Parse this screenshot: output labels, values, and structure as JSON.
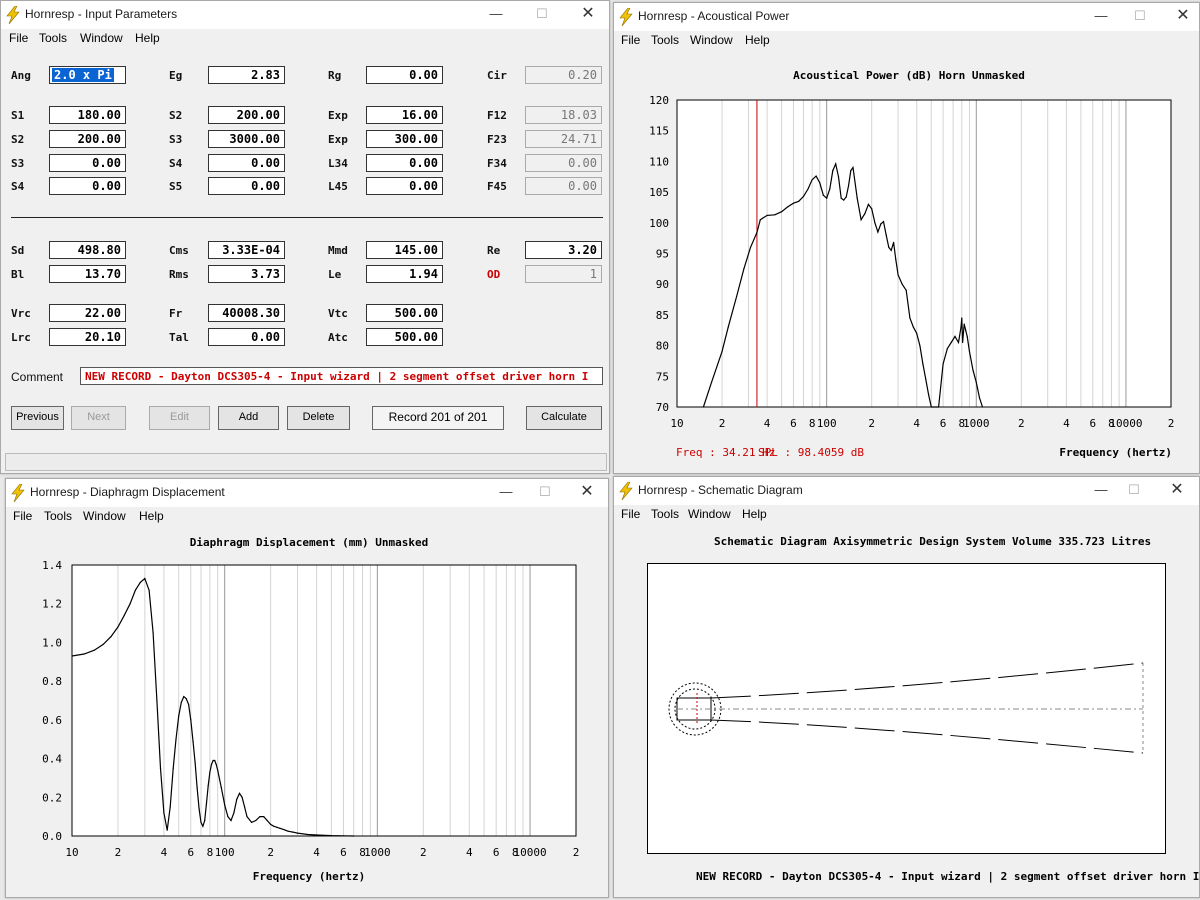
{
  "icons": {
    "app": "hornresp-lightning-icon",
    "minimize": "minimize-icon",
    "maximize": "maximize-icon",
    "close": "close-icon"
  },
  "colors": {
    "red_label": "#cc0000",
    "selection": "#0a64d2",
    "marker": "#cc0000"
  },
  "menu": {
    "file": "File",
    "tools": "Tools",
    "window": "Window",
    "help": "Help"
  },
  "input_window": {
    "title": "Hornresp - Input Parameters",
    "fields": {
      "ang": {
        "label": "Ang",
        "value": "2.0 x Pi"
      },
      "eg": {
        "label": "Eg",
        "value": "2.83"
      },
      "rg": {
        "label": "Rg",
        "value": "0.00"
      },
      "cir": {
        "label": "Cir",
        "value": "0.20"
      },
      "s1": {
        "label": "S1",
        "value": "180.00"
      },
      "s2a": {
        "label": "S2",
        "value": "200.00"
      },
      "exp1": {
        "label": "Exp",
        "value": "16.00"
      },
      "f12": {
        "label": "F12",
        "value": "18.03"
      },
      "s2b": {
        "label": "S2",
        "value": "200.00"
      },
      "s3a": {
        "label": "S3",
        "value": "3000.00"
      },
      "exp2": {
        "label": "Exp",
        "value": "300.00"
      },
      "f23": {
        "label": "F23",
        "value": "24.71"
      },
      "s3b": {
        "label": "S3",
        "value": "0.00"
      },
      "s4a": {
        "label": "S4",
        "value": "0.00"
      },
      "l34": {
        "label": "L34",
        "value": "0.00"
      },
      "f34": {
        "label": "F34",
        "value": "0.00"
      },
      "s4b": {
        "label": "S4",
        "value": "0.00"
      },
      "s5": {
        "label": "S5",
        "value": "0.00"
      },
      "l45": {
        "label": "L45",
        "value": "0.00"
      },
      "f45": {
        "label": "F45",
        "value": "0.00"
      },
      "sd": {
        "label": "Sd",
        "value": "498.80"
      },
      "cms": {
        "label": "Cms",
        "value": "3.33E-04"
      },
      "mmd": {
        "label": "Mmd",
        "value": "145.00"
      },
      "re": {
        "label": "Re",
        "value": "3.20"
      },
      "bl": {
        "label": "Bl",
        "value": "13.70"
      },
      "rms": {
        "label": "Rms",
        "value": "3.73"
      },
      "le": {
        "label": "Le",
        "value": "1.94"
      },
      "od": {
        "label": "OD",
        "value": "1"
      },
      "vrc": {
        "label": "Vrc",
        "value": "22.00"
      },
      "fr": {
        "label": "Fr",
        "value": "40008.30"
      },
      "vtc": {
        "label": "Vtc",
        "value": "500.00"
      },
      "lrc": {
        "label": "Lrc",
        "value": "20.10"
      },
      "tal": {
        "label": "Tal",
        "value": "0.00"
      },
      "atc": {
        "label": "Atc",
        "value": "500.00"
      }
    },
    "comment_label": "Comment",
    "comment_value": "NEW RECORD - Dayton DCS305-4 - Input wizard | 2 segment offset driver horn I",
    "buttons": {
      "previous": "Previous",
      "next": "Next",
      "edit": "Edit",
      "add": "Add",
      "delete": "Delete",
      "calculate": "Calculate"
    },
    "record": "Record 201 of 201"
  },
  "acoustical_window": {
    "title": "Hornresp - Acoustical Power",
    "readout_freq": "Freq : 34.21 Hz",
    "readout_spl": "SPL : 98.4059 dB",
    "chart_data": {
      "type": "line",
      "title": "Acoustical Power (dB)   Horn   Unmasked",
      "xlabel": "Frequency (hertz)",
      "ylabel": "",
      "xscale": "log",
      "xlim": [
        10,
        20000
      ],
      "ylim": [
        70,
        120
      ],
      "x_ticks": [
        "10",
        "2",
        "4",
        "6",
        "8",
        "100",
        "2",
        "4",
        "6",
        "8",
        "1000",
        "2",
        "4",
        "6",
        "8",
        "10000",
        "2"
      ],
      "y_ticks": [
        "120",
        "115",
        "110",
        "105",
        "100",
        "95",
        "90",
        "85",
        "80",
        "75",
        "70"
      ],
      "marker_x": 34.21,
      "series": [
        {
          "x": [
            15,
            17,
            20,
            22,
            25,
            28,
            31,
            34.21,
            36,
            40,
            45,
            50,
            55,
            60,
            65,
            70,
            75,
            80,
            85,
            90,
            95,
            100,
            105,
            110,
            115,
            120,
            125,
            130,
            135,
            140,
            145,
            150,
            160,
            170,
            180,
            190,
            200,
            210,
            220,
            230,
            240,
            250,
            260,
            270,
            280,
            290,
            300,
            320,
            340,
            360,
            380,
            400,
            420,
            440,
            460,
            480,
            500,
            520,
            540,
            560
          ],
          "values": [
            70,
            74,
            79,
            83,
            88,
            92.5,
            96,
            98.4,
            100.5,
            101.2,
            101.3,
            101.8,
            102.6,
            103.2,
            103.5,
            104.3,
            105.5,
            107,
            107.6,
            106.5,
            104.5,
            104,
            105.5,
            108.5,
            109.6,
            107.5,
            104,
            103.7,
            104.2,
            106,
            108.5,
            109,
            104,
            100.5,
            101.5,
            103,
            102.3,
            100,
            98.5,
            99.8,
            100.2,
            98,
            96,
            95.5,
            96.8,
            94,
            91.5,
            90,
            89,
            84.5,
            83,
            82,
            80,
            77,
            74.5,
            72,
            70,
            70,
            70,
            70
          ]
        },
        {
          "x": [
            560,
            600,
            640,
            680,
            720,
            760,
            790,
            800,
            810,
            830,
            850,
            870,
            900,
            950,
            1000,
            1050,
            1100
          ],
          "values": [
            70,
            77,
            79.5,
            80.5,
            81.5,
            80.5,
            83,
            84.5,
            80.5,
            83.5,
            82.5,
            81.5,
            79,
            76,
            74,
            71.5,
            70
          ]
        }
      ]
    }
  },
  "displacement_window": {
    "title": "Hornresp - Diaphragm Displacement",
    "chart_data": {
      "type": "line",
      "title": "Diaphragm Displacement (mm)   Unmasked",
      "xlabel": "Frequency (hertz)",
      "ylabel": "",
      "xscale": "log",
      "xlim": [
        10,
        20000
      ],
      "ylim": [
        0,
        1.4
      ],
      "x_ticks": [
        "10",
        "2",
        "4",
        "6",
        "8",
        "100",
        "2",
        "4",
        "6",
        "8",
        "1000",
        "2",
        "4",
        "6",
        "8",
        "10000",
        "2"
      ],
      "y_ticks": [
        "1.4",
        "1.2",
        "1.0",
        "0.8",
        "0.6",
        "0.4",
        "0.2",
        "0.0"
      ],
      "series": [
        {
          "x": [
            10,
            12,
            14,
            16,
            18,
            20,
            22,
            24,
            26,
            28,
            30,
            32,
            34,
            36,
            38,
            40,
            42,
            44,
            46,
            48,
            50,
            52,
            54,
            56,
            58,
            60,
            62,
            64,
            66,
            68,
            70,
            72,
            74,
            76,
            78,
            80,
            82,
            84,
            86,
            88,
            90,
            95,
            100,
            105,
            110,
            115,
            120,
            125,
            130,
            135,
            140,
            150,
            160,
            170,
            180,
            190,
            200,
            210,
            220,
            230,
            240,
            250,
            260,
            280,
            300,
            350,
            400,
            500,
            600,
            700
          ],
          "values": [
            0.93,
            0.94,
            0.96,
            0.99,
            1.03,
            1.08,
            1.14,
            1.2,
            1.27,
            1.31,
            1.33,
            1.27,
            1.05,
            0.7,
            0.35,
            0.12,
            0.03,
            0.15,
            0.35,
            0.5,
            0.62,
            0.69,
            0.72,
            0.71,
            0.68,
            0.6,
            0.49,
            0.38,
            0.25,
            0.14,
            0.07,
            0.05,
            0.08,
            0.17,
            0.26,
            0.33,
            0.37,
            0.39,
            0.39,
            0.37,
            0.34,
            0.25,
            0.16,
            0.1,
            0.08,
            0.12,
            0.19,
            0.22,
            0.2,
            0.15,
            0.1,
            0.07,
            0.08,
            0.1,
            0.1,
            0.08,
            0.06,
            0.05,
            0.045,
            0.04,
            0.035,
            0.03,
            0.025,
            0.02,
            0.015,
            0.008,
            0.005,
            0.002,
            0.001,
            0.0
          ]
        }
      ]
    }
  },
  "schematic_window": {
    "title": "Hornresp - Schematic Diagram",
    "heading": "Schematic Diagram   Axisymmetric Design   System Volume 335.723 Litres",
    "footer": "NEW RECORD - Dayton DCS305-4 - Input wizard | 2 segment offset driver horn I"
  }
}
